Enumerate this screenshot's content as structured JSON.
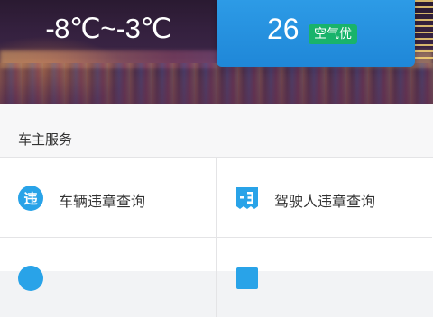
{
  "weather": {
    "temperature_range": "-8℃~-3℃",
    "aqi_value": "26",
    "aqi_label": "空气优"
  },
  "services": {
    "section_title": "车主服务",
    "items": [
      {
        "label": "车辆违章查询",
        "icon": "violation-icon",
        "icon_char": "违"
      },
      {
        "label": "驾驶人违章查询",
        "icon": "driver-license-icon",
        "icon_char": ""
      },
      {
        "label": "",
        "icon": "service-icon"
      },
      {
        "label": "",
        "icon": "service-icon"
      }
    ]
  },
  "colors": {
    "accent_blue": "#1f8ee0",
    "aqi_green": "#19b36b",
    "icon_blue": "#29a3e8"
  }
}
